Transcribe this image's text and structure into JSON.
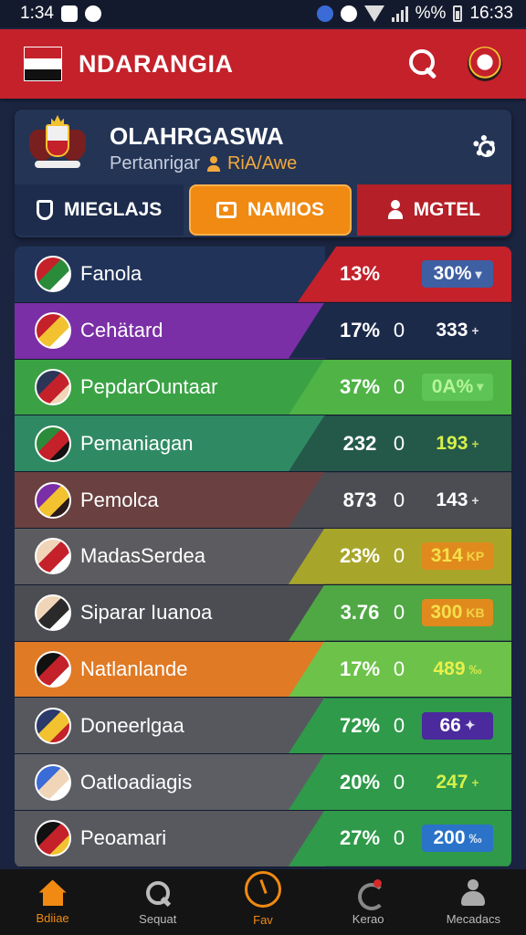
{
  "status": {
    "time": "1:34",
    "battery": "%%",
    "clock": "16:33"
  },
  "appbar": {
    "title": "NDARANGIA",
    "search_icon": "search-icon",
    "crest_icon": "team-crest-icon"
  },
  "card": {
    "title": "OLAHRGASWA",
    "subtitle_prefix": "Pertanrigar",
    "subtitle_accent": "RiA/Awe"
  },
  "tabs": [
    {
      "label": "MIEGLAJS",
      "icon": "shield-icon",
      "active": false
    },
    {
      "label": "NAMIOS",
      "icon": "camera-icon",
      "active": true
    },
    {
      "label": "MGTEL",
      "icon": "user-icon",
      "active": false
    }
  ],
  "rows": [
    {
      "name": "Fanola",
      "v1": "13%",
      "zero": "",
      "v2": "30%",
      "mark": "▾",
      "left": "#213358",
      "right": "#c4212b",
      "v2bg": "#3f5fa3",
      "v2color": "#ffffff",
      "logo": [
        "#c4212b",
        "#2a8c3a",
        "#ffffff"
      ]
    },
    {
      "name": "Cehätard",
      "v1": "17%",
      "zero": "0",
      "v2": "333",
      "mark": "+",
      "left": "#7b2fa6",
      "right": "#1c2a4a",
      "v2bg": "transparent",
      "v2color": "#ffffff",
      "logo": [
        "#c4212b",
        "#f2c230",
        "#ffffff"
      ]
    },
    {
      "name": "PepdarOuntaar",
      "v1": "37%",
      "zero": "0",
      "v2": "0A%",
      "mark": "▾",
      "left": "#3aa244",
      "right": "#4fb346",
      "v2bg": "#5dc455",
      "v2color": "#b6f59b",
      "logo": [
        "#2a3558",
        "#c4212b",
        "#f0d5b8"
      ]
    },
    {
      "name": "Pemaniagan",
      "v1": "232",
      "zero": "0",
      "v2": "193",
      "mark": "+",
      "left": "#2f8a64",
      "right": "#24594a",
      "v2bg": "transparent",
      "v2color": "#d6f04a",
      "logo": [
        "#2a8c3a",
        "#c4212b",
        "#111111"
      ]
    },
    {
      "name": "Pemolca",
      "v1": "873",
      "zero": "0",
      "v2": "143",
      "mark": "+",
      "left": "#6a4040",
      "right": "#4b4d52",
      "v2bg": "transparent",
      "v2color": "#ffffff",
      "logo": [
        "#7b2fa6",
        "#f2c230",
        "#2a1a1a"
      ]
    },
    {
      "name": "MadasSerdea",
      "v1": "23%",
      "zero": "0",
      "v2": "314",
      "mark": "KP",
      "left": "#5c5c60",
      "right": "#a8a62a",
      "v2bg": "#e08a1e",
      "v2color": "#f5e04a",
      "logo": [
        "#f0d5b8",
        "#c4212b",
        "#ffffff"
      ]
    },
    {
      "name": "Siparar Iuanoa",
      "v1": "3.76",
      "zero": "0",
      "v2": "300",
      "mark": "KB",
      "left": "#4b4d52",
      "right": "#4fa844",
      "v2bg": "#e08a1e",
      "v2color": "#f5e04a",
      "logo": [
        "#f0d5b8",
        "#2a2a2a",
        "#ffffff"
      ]
    },
    {
      "name": "Natlanlande",
      "v1": "17%",
      "zero": "0",
      "v2": "489",
      "mark": "‰",
      "left": "#e07a25",
      "right": "#6dc24a",
      "v2bg": "transparent",
      "v2color": "#e8f04a",
      "logo": [
        "#111111",
        "#c4212b",
        "#ffffff"
      ]
    },
    {
      "name": "Doneerlgaa",
      "v1": "72%",
      "zero": "0",
      "v2": "66",
      "mark": "✦",
      "left": "#56585e",
      "right": "#2f9a4a",
      "v2bg": "#4a2a9c",
      "v2color": "#ffffff",
      "logo": [
        "#2a3a6a",
        "#f2c230",
        "#c4212b"
      ]
    },
    {
      "name": "Oatloadiagis",
      "v1": "20%",
      "zero": "0",
      "v2": "247",
      "mark": "+",
      "left": "#5c5e64",
      "right": "#2f9a4a",
      "v2bg": "transparent",
      "v2color": "#d6f04a",
      "logo": [
        "#3a6bd6",
        "#f0d5b8",
        "#ffffff"
      ]
    },
    {
      "name": "Peoamari",
      "v1": "27%",
      "zero": "0",
      "v2": "200",
      "mark": "‰",
      "left": "#58595e",
      "right": "#2f9a4a",
      "v2bg": "#2a73c9",
      "v2color": "#ffffff",
      "logo": [
        "#111111",
        "#c4212b",
        "#f2c230"
      ]
    }
  ],
  "nav": [
    {
      "label": "Bdiiae",
      "icon": "home-icon",
      "active": true
    },
    {
      "label": "Sequat",
      "icon": "search-icon",
      "active": false
    },
    {
      "label": "Fav",
      "icon": "clock-icon",
      "active": true
    },
    {
      "label": "Kerao",
      "icon": "notification-icon",
      "active": false
    },
    {
      "label": "Mecadacs",
      "icon": "people-icon",
      "active": false
    }
  ]
}
